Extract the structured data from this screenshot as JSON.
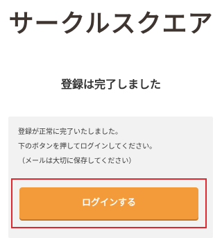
{
  "header": {
    "logo_text": "サークルスクエア"
  },
  "main": {
    "title": "登録は完了しました",
    "message_lines": [
      "登録が正常に完了いたしました。",
      "下のボタンを押してログインしてください。",
      "（メールは大切に保存してください）"
    ],
    "login_button_label": "ログインする"
  },
  "colors": {
    "button": "#f39a3b",
    "highlight_frame": "#e0262e",
    "panel_background": "#f2f2f2",
    "logo": "#3e3430"
  }
}
